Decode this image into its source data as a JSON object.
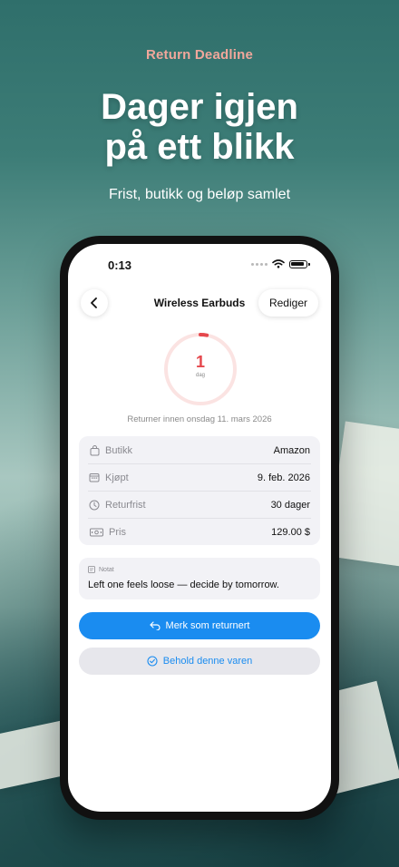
{
  "hero": {
    "eyebrow": "Return Deadline",
    "headline_line1": "Dager igjen",
    "headline_line2": "på ett blikk",
    "subline": "Frist, butikk og beløp samlet"
  },
  "status_bar": {
    "time": "0:13"
  },
  "nav": {
    "title": "Wireless Earbuds",
    "edit_label": "Rediger"
  },
  "countdown": {
    "value": "1",
    "unit": "dag",
    "progress_fraction": 0.03,
    "caption": "Returner innen onsdag 11. mars 2026"
  },
  "details": [
    {
      "icon": "bag-icon",
      "label": "Butikk",
      "value": "Amazon"
    },
    {
      "icon": "calendar-icon",
      "label": "Kjøpt",
      "value": "9. feb. 2026"
    },
    {
      "icon": "clock-icon",
      "label": "Returfrist",
      "value": "30 dager"
    },
    {
      "icon": "banknote-icon",
      "label": "Pris",
      "value": "129.00 $"
    }
  ],
  "note": {
    "label": "Notat",
    "text": "Left one feels loose — decide by tomorrow."
  },
  "actions": {
    "primary_label": "Merk som returnert",
    "secondary_label": "Behold denne varen"
  },
  "colors": {
    "accent": "#1a8cf0",
    "countdown": "#e5484d",
    "eyebrow": "#f1a79b"
  }
}
